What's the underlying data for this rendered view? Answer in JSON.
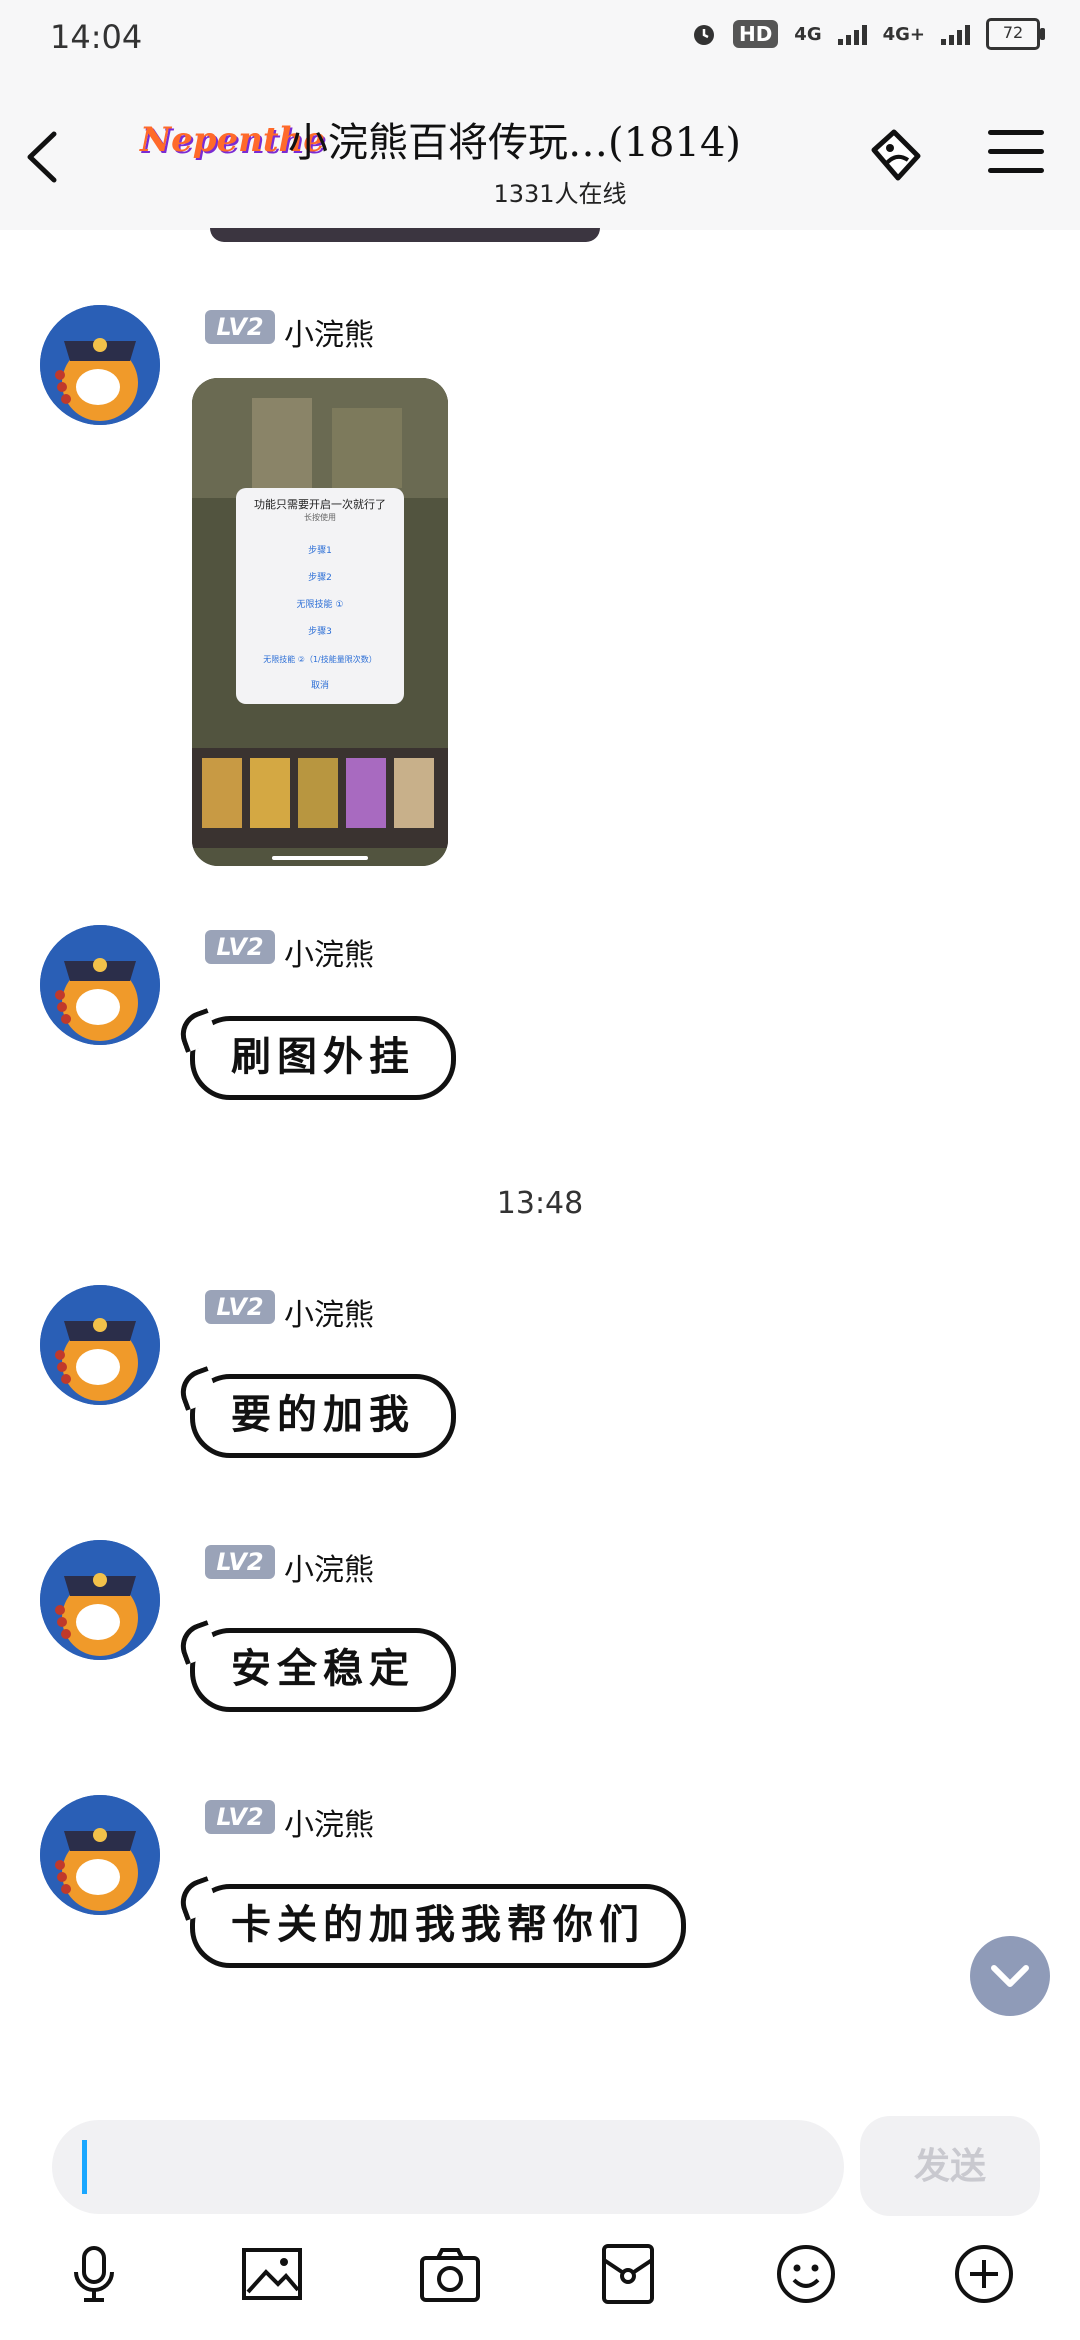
{
  "status_bar": {
    "time": "14:04",
    "hd_label": "HD",
    "network_1": "4G",
    "network_2": "4G+",
    "battery": "72"
  },
  "header": {
    "logo_text": "Nepenthe",
    "title": "小浣熊百将传玩…(1814)",
    "online_count": "1331人在线"
  },
  "messages": [
    {
      "level": "LV2",
      "sender": "小浣熊",
      "type": "image"
    },
    {
      "level": "LV2",
      "sender": "小浣熊",
      "text": "刷图外挂"
    },
    {
      "level": "LV2",
      "sender": "小浣熊",
      "text": "要的加我"
    },
    {
      "level": "LV2",
      "sender": "小浣熊",
      "text": "安全稳定"
    },
    {
      "level": "LV2",
      "sender": "小浣熊",
      "text": "卡关的加我我帮你们"
    }
  ],
  "time_separator": "13:48",
  "image_dialog": {
    "title": "功能只需要开启一次就行了",
    "subtitle": "长按使用",
    "options": [
      "步骤1",
      "步骤2",
      "无限技能 ①",
      "步骤3",
      "无限技能 ②（1/技能量限次数）",
      "取消"
    ]
  },
  "input": {
    "placeholder": "",
    "send_label": "发送"
  },
  "toolbar": [
    "mic-icon",
    "image-icon",
    "camera-icon",
    "red-packet-icon",
    "emoji-icon",
    "plus-icon"
  ],
  "colors": {
    "lv_badge": "#9aa3b8",
    "caret": "#1aa7ff",
    "scroll_button": "#8f9bb8"
  }
}
